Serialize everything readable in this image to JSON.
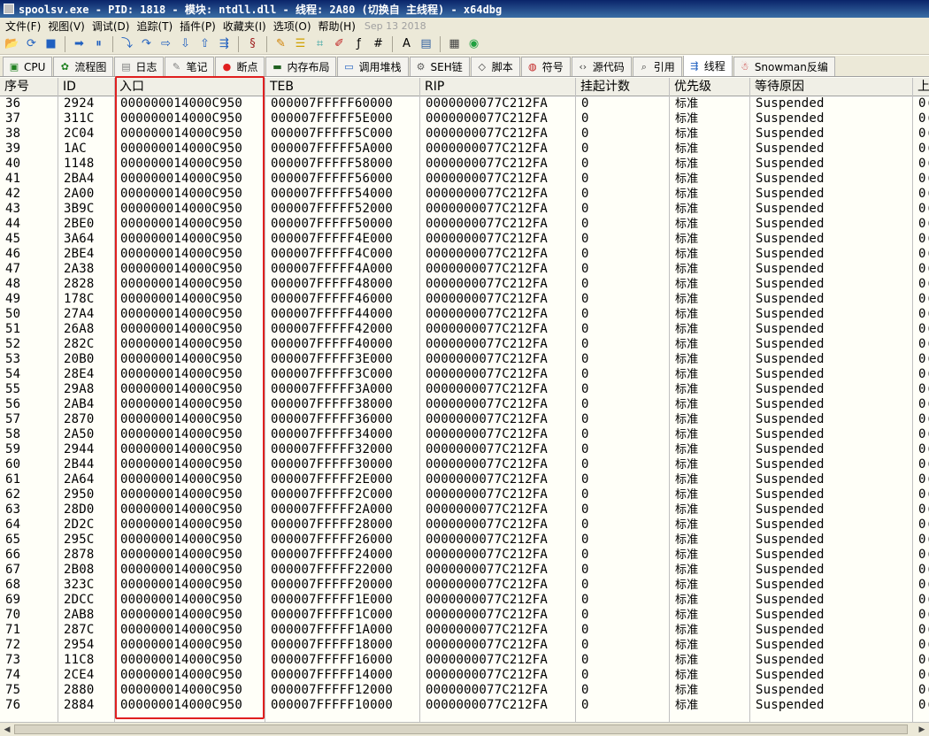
{
  "window": {
    "title": "spoolsv.exe - PID: 1818 - 模块: ntdll.dll - 线程: 2A80 (切换自 主线程) - x64dbg"
  },
  "menu": {
    "items": [
      "文件(F)",
      "视图(V)",
      "调试(D)",
      "追踪(T)",
      "插件(P)",
      "收藏夹(I)",
      "选项(O)",
      "帮助(H)"
    ],
    "date": "Sep 13 2018"
  },
  "toolbar": {
    "icons": [
      "open-icon",
      "restart-icon",
      "stop-icon",
      "run-icon",
      "pause-icon",
      "step-into-icon",
      "step-over-icon",
      "trace-into-icon",
      "trace-over-icon",
      "run-to-user-icon",
      "animate-icon",
      "script-icon",
      "patch-icon",
      "comment-icon",
      "label-icon",
      "bookmark-icon",
      "function-icon",
      "hash-icon",
      "font-icon",
      "module-icon",
      "calculator-icon",
      "web-icon"
    ]
  },
  "tabs": [
    {
      "label": "CPU",
      "icon": "cpu-icon"
    },
    {
      "label": "流程图",
      "icon": "graph-icon"
    },
    {
      "label": "日志",
      "icon": "log-icon"
    },
    {
      "label": "笔记",
      "icon": "notes-icon"
    },
    {
      "label": "断点",
      "icon": "breakpoint-icon"
    },
    {
      "label": "内存布局",
      "icon": "memory-icon"
    },
    {
      "label": "调用堆栈",
      "icon": "callstack-icon"
    },
    {
      "label": "SEH链",
      "icon": "seh-icon"
    },
    {
      "label": "脚本",
      "icon": "script-icon"
    },
    {
      "label": "符号",
      "icon": "symbols-icon"
    },
    {
      "label": "源代码",
      "icon": "source-icon"
    },
    {
      "label": "引用",
      "icon": "references-icon"
    },
    {
      "label": "线程",
      "icon": "threads-icon",
      "active": true
    },
    {
      "label": "Snowman反编",
      "icon": "snowman-icon"
    }
  ],
  "table": {
    "columns": [
      "序号",
      "ID",
      "入口",
      "TEB",
      "RIP",
      "挂起计数",
      "优先级",
      "等待原因",
      "上"
    ],
    "rows": [
      [
        "36",
        "2924",
        "000000014000C950",
        "000007FFFFF60000",
        "0000000077C212FA",
        "0",
        "标准",
        "Suspended",
        "0("
      ],
      [
        "37",
        "311C",
        "000000014000C950",
        "000007FFFFF5E000",
        "0000000077C212FA",
        "0",
        "标准",
        "Suspended",
        "0("
      ],
      [
        "38",
        "2C04",
        "000000014000C950",
        "000007FFFFF5C000",
        "0000000077C212FA",
        "0",
        "标准",
        "Suspended",
        "0("
      ],
      [
        "39",
        "1AC",
        "000000014000C950",
        "000007FFFFF5A000",
        "0000000077C212FA",
        "0",
        "标准",
        "Suspended",
        "0("
      ],
      [
        "40",
        "1148",
        "000000014000C950",
        "000007FFFFF58000",
        "0000000077C212FA",
        "0",
        "标准",
        "Suspended",
        "0("
      ],
      [
        "41",
        "2BA4",
        "000000014000C950",
        "000007FFFFF56000",
        "0000000077C212FA",
        "0",
        "标准",
        "Suspended",
        "0("
      ],
      [
        "42",
        "2A00",
        "000000014000C950",
        "000007FFFFF54000",
        "0000000077C212FA",
        "0",
        "标准",
        "Suspended",
        "0("
      ],
      [
        "43",
        "3B9C",
        "000000014000C950",
        "000007FFFFF52000",
        "0000000077C212FA",
        "0",
        "标准",
        "Suspended",
        "0("
      ],
      [
        "44",
        "2BE0",
        "000000014000C950",
        "000007FFFFF50000",
        "0000000077C212FA",
        "0",
        "标准",
        "Suspended",
        "0("
      ],
      [
        "45",
        "3A64",
        "000000014000C950",
        "000007FFFFF4E000",
        "0000000077C212FA",
        "0",
        "标准",
        "Suspended",
        "0("
      ],
      [
        "46",
        "2BE4",
        "000000014000C950",
        "000007FFFFF4C000",
        "0000000077C212FA",
        "0",
        "标准",
        "Suspended",
        "0("
      ],
      [
        "47",
        "2A38",
        "000000014000C950",
        "000007FFFFF4A000",
        "0000000077C212FA",
        "0",
        "标准",
        "Suspended",
        "0("
      ],
      [
        "48",
        "2828",
        "000000014000C950",
        "000007FFFFF48000",
        "0000000077C212FA",
        "0",
        "标准",
        "Suspended",
        "0("
      ],
      [
        "49",
        "178C",
        "000000014000C950",
        "000007FFFFF46000",
        "0000000077C212FA",
        "0",
        "标准",
        "Suspended",
        "0("
      ],
      [
        "50",
        "27A4",
        "000000014000C950",
        "000007FFFFF44000",
        "0000000077C212FA",
        "0",
        "标准",
        "Suspended",
        "0("
      ],
      [
        "51",
        "26A8",
        "000000014000C950",
        "000007FFFFF42000",
        "0000000077C212FA",
        "0",
        "标准",
        "Suspended",
        "0("
      ],
      [
        "52",
        "282C",
        "000000014000C950",
        "000007FFFFF40000",
        "0000000077C212FA",
        "0",
        "标准",
        "Suspended",
        "0("
      ],
      [
        "53",
        "20B0",
        "000000014000C950",
        "000007FFFFF3E000",
        "0000000077C212FA",
        "0",
        "标准",
        "Suspended",
        "0("
      ],
      [
        "54",
        "28E4",
        "000000014000C950",
        "000007FFFFF3C000",
        "0000000077C212FA",
        "0",
        "标准",
        "Suspended",
        "0("
      ],
      [
        "55",
        "29A8",
        "000000014000C950",
        "000007FFFFF3A000",
        "0000000077C212FA",
        "0",
        "标准",
        "Suspended",
        "0("
      ],
      [
        "56",
        "2AB4",
        "000000014000C950",
        "000007FFFFF38000",
        "0000000077C212FA",
        "0",
        "标准",
        "Suspended",
        "0("
      ],
      [
        "57",
        "2870",
        "000000014000C950",
        "000007FFFFF36000",
        "0000000077C212FA",
        "0",
        "标准",
        "Suspended",
        "0("
      ],
      [
        "58",
        "2A50",
        "000000014000C950",
        "000007FFFFF34000",
        "0000000077C212FA",
        "0",
        "标准",
        "Suspended",
        "0("
      ],
      [
        "59",
        "2944",
        "000000014000C950",
        "000007FFFFF32000",
        "0000000077C212FA",
        "0",
        "标准",
        "Suspended",
        "0("
      ],
      [
        "60",
        "2B44",
        "000000014000C950",
        "000007FFFFF30000",
        "0000000077C212FA",
        "0",
        "标准",
        "Suspended",
        "0("
      ],
      [
        "61",
        "2A64",
        "000000014000C950",
        "000007FFFFF2E000",
        "0000000077C212FA",
        "0",
        "标准",
        "Suspended",
        "0("
      ],
      [
        "62",
        "2950",
        "000000014000C950",
        "000007FFFFF2C000",
        "0000000077C212FA",
        "0",
        "标准",
        "Suspended",
        "0("
      ],
      [
        "63",
        "28D0",
        "000000014000C950",
        "000007FFFFF2A000",
        "0000000077C212FA",
        "0",
        "标准",
        "Suspended",
        "0("
      ],
      [
        "64",
        "2D2C",
        "000000014000C950",
        "000007FFFFF28000",
        "0000000077C212FA",
        "0",
        "标准",
        "Suspended",
        "0("
      ],
      [
        "65",
        "295C",
        "000000014000C950",
        "000007FFFFF26000",
        "0000000077C212FA",
        "0",
        "标准",
        "Suspended",
        "0("
      ],
      [
        "66",
        "2878",
        "000000014000C950",
        "000007FFFFF24000",
        "0000000077C212FA",
        "0",
        "标准",
        "Suspended",
        "0("
      ],
      [
        "67",
        "2B08",
        "000000014000C950",
        "000007FFFFF22000",
        "0000000077C212FA",
        "0",
        "标准",
        "Suspended",
        "0("
      ],
      [
        "68",
        "323C",
        "000000014000C950",
        "000007FFFFF20000",
        "0000000077C212FA",
        "0",
        "标准",
        "Suspended",
        "0("
      ],
      [
        "69",
        "2DCC",
        "000000014000C950",
        "000007FFFFF1E000",
        "0000000077C212FA",
        "0",
        "标准",
        "Suspended",
        "0("
      ],
      [
        "70",
        "2AB8",
        "000000014000C950",
        "000007FFFFF1C000",
        "0000000077C212FA",
        "0",
        "标准",
        "Suspended",
        "0("
      ],
      [
        "71",
        "287C",
        "000000014000C950",
        "000007FFFFF1A000",
        "0000000077C212FA",
        "0",
        "标准",
        "Suspended",
        "0("
      ],
      [
        "72",
        "2954",
        "000000014000C950",
        "000007FFFFF18000",
        "0000000077C212FA",
        "0",
        "标准",
        "Suspended",
        "0("
      ],
      [
        "73",
        "11C8",
        "000000014000C950",
        "000007FFFFF16000",
        "0000000077C212FA",
        "0",
        "标准",
        "Suspended",
        "0("
      ],
      [
        "74",
        "2CE4",
        "000000014000C950",
        "000007FFFFF14000",
        "0000000077C212FA",
        "0",
        "标准",
        "Suspended",
        "0("
      ],
      [
        "75",
        "2880",
        "000000014000C950",
        "000007FFFFF12000",
        "0000000077C212FA",
        "0",
        "标准",
        "Suspended",
        "0("
      ],
      [
        "76",
        "2884",
        "000000014000C950",
        "000007FFFFF10000",
        "0000000077C212FA",
        "0",
        "标准",
        "Suspended",
        "0("
      ]
    ]
  },
  "colors": {
    "highlight": "#e02020",
    "title_bar": "#0a246a"
  }
}
